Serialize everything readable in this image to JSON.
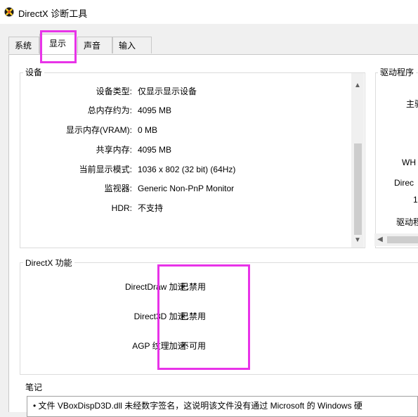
{
  "window": {
    "title": "DirectX 诊断工具"
  },
  "tabs": [
    {
      "label": "系统"
    },
    {
      "label": "显示"
    },
    {
      "label": "声音"
    },
    {
      "label": "输入"
    }
  ],
  "device": {
    "title": "设备",
    "rows": [
      {
        "label": "设备类型:",
        "value": "仅显示显示设备"
      },
      {
        "label": "总内存约为:",
        "value": "4095 MB"
      },
      {
        "label": "显示内存(VRAM):",
        "value": "0 MB"
      },
      {
        "label": "共享内存:",
        "value": "4095 MB"
      },
      {
        "label": "当前显示模式:",
        "value": "1036 x 802 (32 bit) (64Hz)"
      },
      {
        "label": "监视器:",
        "value": "Generic Non-PnP Monitor"
      },
      {
        "label": "HDR:",
        "value": "不支持"
      }
    ]
  },
  "driver": {
    "title": "驱动程序",
    "partial_labels": [
      "主驱",
      "WH",
      "Direc",
      "1",
      "驱动程"
    ]
  },
  "features": {
    "title": "DirectX 功能",
    "rows": [
      {
        "label": "DirectDraw 加速:",
        "value": "已禁用"
      },
      {
        "label": "Direct3D 加速:",
        "value": "已禁用"
      },
      {
        "label": "AGP 纹理加速:",
        "value": "不可用"
      }
    ]
  },
  "notes": {
    "title": "笔记",
    "line": "• 文件 VBoxDispD3D.dll 未经数字签名，这说明该文件没有通过 Microsoft 的 Windows 硬"
  },
  "colors": {
    "highlight": "#e833e8",
    "icon_blue": "#2563c9"
  }
}
